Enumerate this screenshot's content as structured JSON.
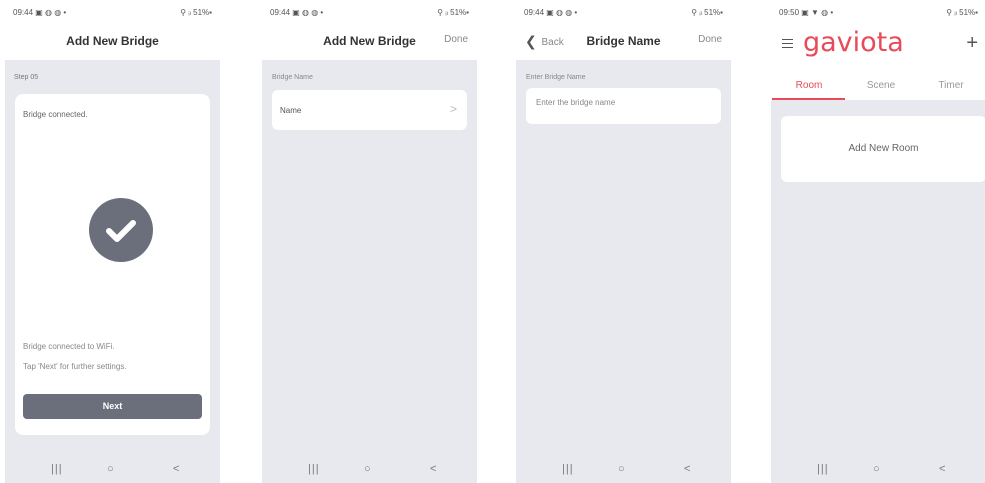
{
  "screens": [
    {
      "status": {
        "time": "09:44 ▣ ◍ ◍ •",
        "battery": "⚲ ᵢₗ 51%▪"
      },
      "header": {
        "title": "Add New Bridge"
      },
      "step_label": "Step 05",
      "card": {
        "title": "Bridge connected.",
        "message1": "Bridge connected to WiFi.",
        "message2": "Tap 'Next' for further settings.",
        "button": "Next"
      },
      "nav": {
        "recent": "|||",
        "home": "○",
        "back": "<"
      }
    },
    {
      "status": {
        "time": "09:44 ▣ ◍ ◍ •",
        "battery": "⚲ ᵢₗ 51%▪"
      },
      "header": {
        "title": "Add New Bridge",
        "right": "Done"
      },
      "section_label": "Bridge Name",
      "row": {
        "label": "Name",
        "chevron": ">"
      },
      "nav": {
        "recent": "|||",
        "home": "○",
        "back": "<"
      }
    },
    {
      "status": {
        "time": "09:44 ▣ ◍ ◍ •",
        "battery": "⚲ ᵢₗ 51%▪"
      },
      "header": {
        "back_chevron": "❮",
        "back": "Back",
        "title": "Bridge Name",
        "right": "Done"
      },
      "section_label": "Enter Bridge Name",
      "input": {
        "placeholder": "Enter the bridge name",
        "value": ""
      },
      "nav": {
        "recent": "|||",
        "home": "○",
        "back": "<"
      }
    },
    {
      "status": {
        "time": "09:50 ▣ ▼ ◍ •",
        "battery": "⚲ ᵢₗ 51%▪"
      },
      "header": {
        "logo": "gaviota",
        "plus": "+"
      },
      "tabs": [
        "Room",
        "Scene",
        "Timer"
      ],
      "active_tab": "Room",
      "room_card": "Add New Room",
      "nav": {
        "recent": "|||",
        "home": "○",
        "back": "<"
      }
    }
  ],
  "colors": {
    "accent": "#e84a5a",
    "button": "#6b6f7c",
    "background": "#e7e9ee"
  },
  "icons": {
    "check": "check-icon",
    "menu": "hamburger-icon",
    "add": "plus-icon",
    "chevron": "chevron-right-icon"
  }
}
